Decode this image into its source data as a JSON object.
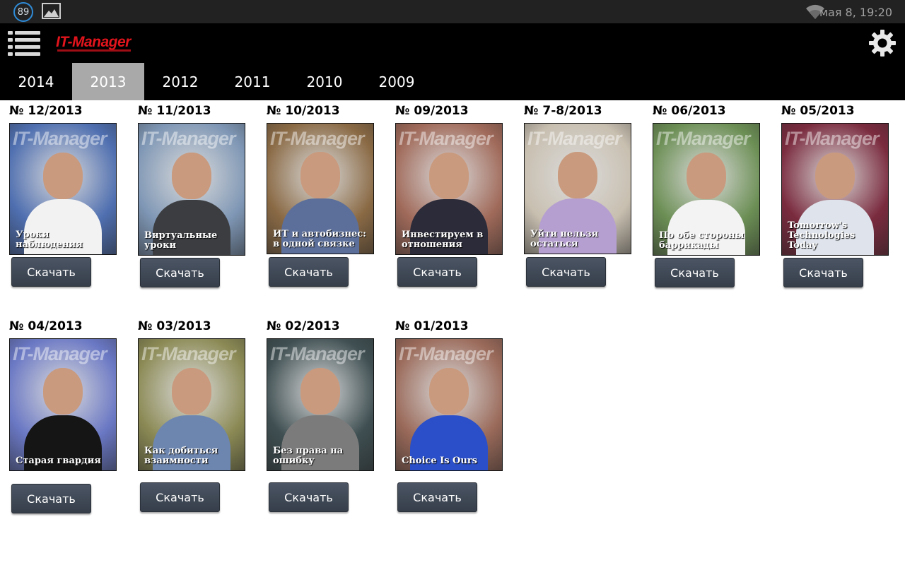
{
  "status_bar": {
    "notification_count": "89",
    "datetime": "мая 8, 19:20",
    "icons": [
      "notification-count-badge",
      "image-icon",
      "wifi-icon"
    ]
  },
  "app_bar": {
    "logo_text": "IT-Manager",
    "menu_icon": "list-menu-icon",
    "settings_icon": "gear-icon"
  },
  "tabs": [
    {
      "label": "2014",
      "active": false
    },
    {
      "label": "2013",
      "active": true
    },
    {
      "label": "2012",
      "active": false
    },
    {
      "label": "2011",
      "active": false
    },
    {
      "label": "2010",
      "active": false
    },
    {
      "label": "2009",
      "active": false
    }
  ],
  "download_label": "Скачать",
  "issues": [
    {
      "title": "№ 12/2013",
      "headline": "Уроки наблюдения",
      "bg": "#4f6fb0",
      "clothes": "#f2f2f2",
      "button": "Скачать"
    },
    {
      "title": "№ 11/2013",
      "headline": "Виртуальные уроки",
      "bg": "#7f97b5",
      "clothes": "#3b3d40",
      "button": "Скачать"
    },
    {
      "title": "№ 10/2013",
      "headline": "ИТ и автобизнес: в одной связке",
      "bg": "#8a6a45",
      "clothes": "#5c6f9a",
      "button": "Скачать"
    },
    {
      "title": "№ 09/2013",
      "headline": "Инвестируем в отношения",
      "bg": "#a06a5a",
      "clothes": "#2b2b3a",
      "button": "Скачать"
    },
    {
      "title": "№ 7-8/2013",
      "headline": "Уйти нельзя остаться",
      "bg": "#c8bfb0",
      "clothes": "#b59fd0",
      "button": "Скачать"
    },
    {
      "title": "№ 06/2013",
      "headline": "По обе стороны баррикады",
      "bg": "#6c8f55",
      "clothes": "#f3f3f3",
      "button": "Скачать"
    },
    {
      "title": "№ 05/2013",
      "headline": "Tomorrow's Technologies Today",
      "bg": "#7a2b3e",
      "clothes": "#dfe4ec",
      "button": "Скачать"
    },
    {
      "title": "№ 04/2013",
      "headline": "Старая гвардия",
      "bg": "#6a78c4",
      "clothes": "#151515",
      "button": "Скачать"
    },
    {
      "title": "№ 03/2013",
      "headline": "Как добиться взаимности",
      "bg": "#8b8a55",
      "clothes": "#6d86b0",
      "button": "Скачать"
    },
    {
      "title": "№ 02/2013",
      "headline": "Без права на ошибку",
      "bg": "#3f4f52",
      "clothes": "#7b7b7b",
      "button": "Скачать"
    },
    {
      "title": "№ 01/2013",
      "headline": "Choice Is Ours",
      "bg": "#9a6a5a",
      "clothes": "#2a4fc8",
      "button": "Скачать"
    }
  ]
}
